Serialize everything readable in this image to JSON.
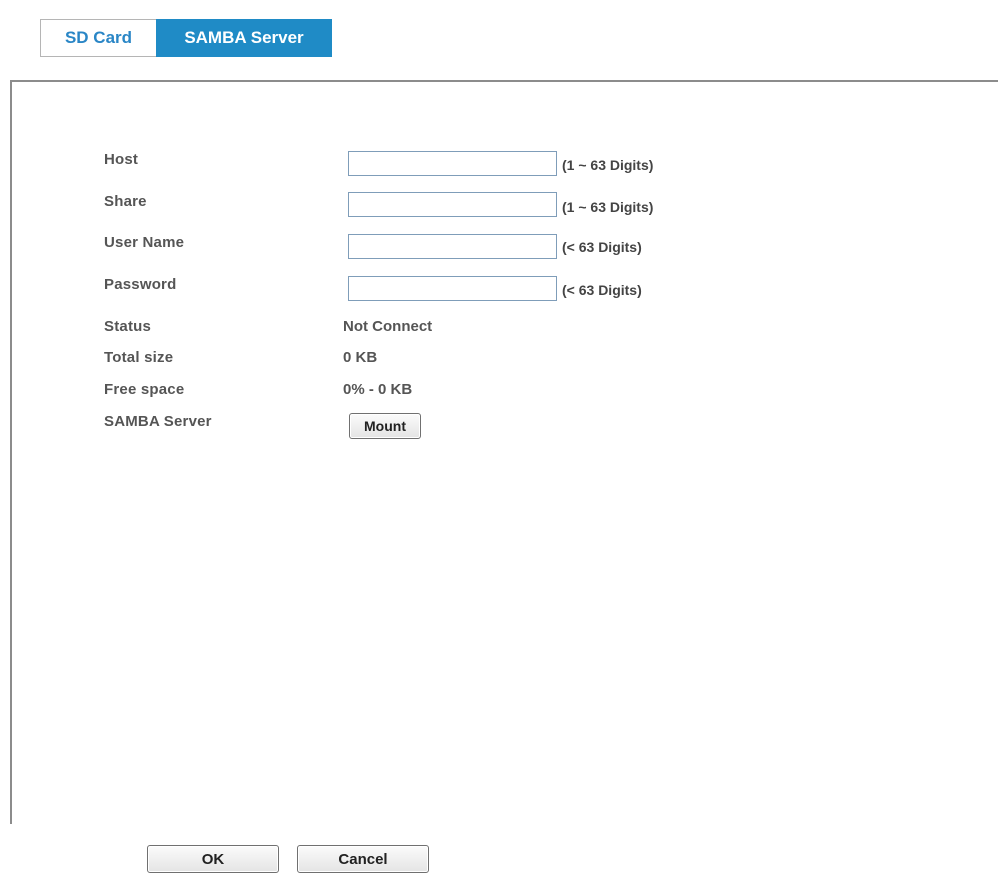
{
  "tabs": [
    {
      "label": "SD Card",
      "active": false
    },
    {
      "label": "SAMBA Server",
      "active": true
    }
  ],
  "form": {
    "host": {
      "label": "Host",
      "value": "",
      "hint": "(1 ~ 63 Digits)"
    },
    "share": {
      "label": "Share",
      "value": "",
      "hint": "(1 ~ 63 Digits)"
    },
    "user_name": {
      "label": "User Name",
      "value": "",
      "hint": "(< 63 Digits)"
    },
    "password": {
      "label": "Password",
      "value": "",
      "hint": "(< 63 Digits)"
    }
  },
  "info": {
    "status": {
      "label": "Status",
      "value": "Not Connect"
    },
    "total_size": {
      "label": "Total size",
      "value": "0 KB"
    },
    "free_space": {
      "label": "Free space",
      "value": "0% - 0 KB"
    },
    "samba_server": {
      "label": "SAMBA Server",
      "button": "Mount"
    }
  },
  "footer": {
    "ok_label": "OK",
    "cancel_label": "Cancel"
  },
  "colors": {
    "tab_active_bg": "#1f8bc6",
    "tab_inactive_text": "#2a86c6",
    "input_border": "#7f9db9"
  }
}
